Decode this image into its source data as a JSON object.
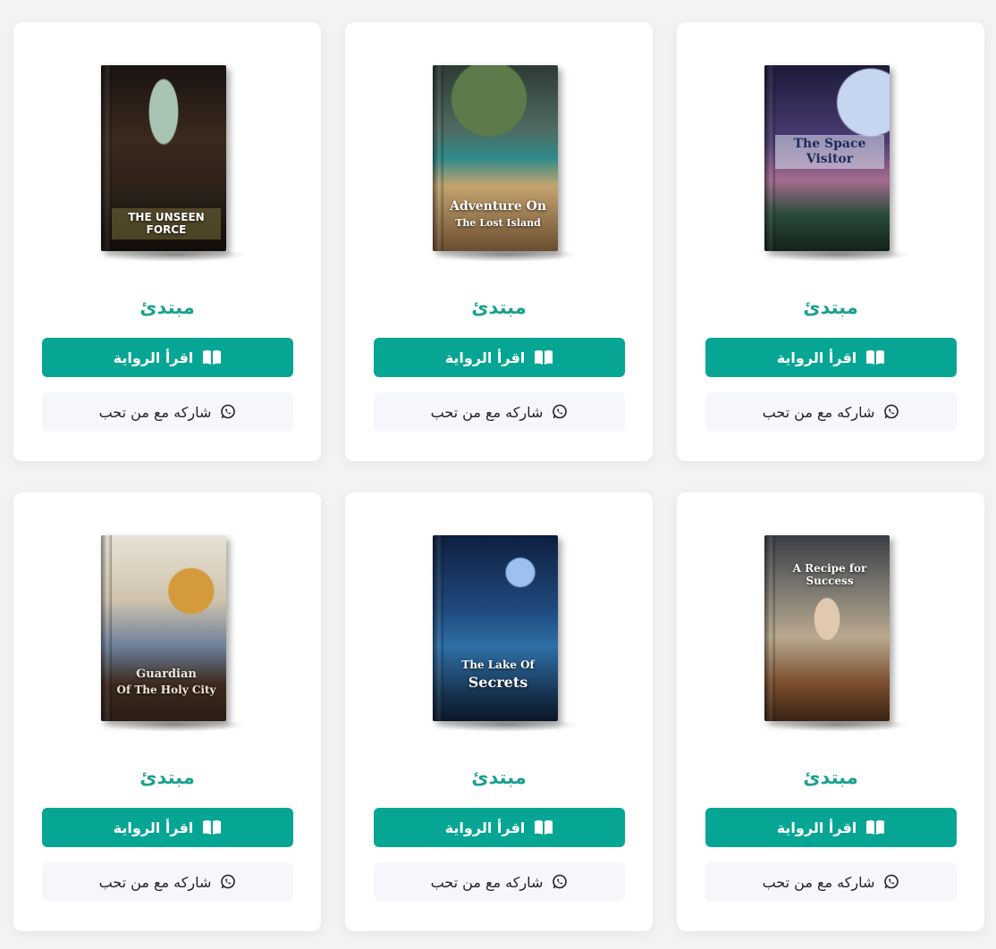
{
  "books": [
    {
      "title_lines": [
        "The Space Visitor"
      ],
      "level": "مبتدئ",
      "read_label": "اقرأ الرواية",
      "share_label": "شاركه مع من تحب",
      "accent": "#07a593"
    },
    {
      "title_lines": [
        "Adventure On",
        "The Lost Island"
      ],
      "level": "مبتدئ",
      "read_label": "اقرأ الرواية",
      "share_label": "شاركه مع من تحب",
      "accent": "#07a593"
    },
    {
      "title_lines": [
        "THE UNSEEN FORCE"
      ],
      "level": "مبتدئ",
      "read_label": "اقرأ الرواية",
      "share_label": "شاركه مع من تحب",
      "accent": "#07a593"
    },
    {
      "title_lines": [
        "A Recipe for Success"
      ],
      "level": "مبتدئ",
      "read_label": "اقرأ الرواية",
      "share_label": "شاركه مع من تحب",
      "accent": "#07a593"
    },
    {
      "title_lines": [
        "The Lake Of",
        "Secrets"
      ],
      "level": "مبتدئ",
      "read_label": "اقرأ الرواية",
      "share_label": "شاركه مع من تحب",
      "accent": "#07a593"
    },
    {
      "title_lines": [
        "Guardian",
        "Of The Holy City"
      ],
      "level": "مبتدئ",
      "read_label": "اقرأ الرواية",
      "share_label": "شاركه مع من تحب",
      "accent": "#07a593"
    }
  ],
  "icons": {
    "read": "open-book-icon",
    "share": "whatsapp-icon"
  },
  "colors": {
    "level_text": "#1aa08f",
    "primary_button": "#07a593",
    "secondary_button": "#f6f7fb"
  }
}
